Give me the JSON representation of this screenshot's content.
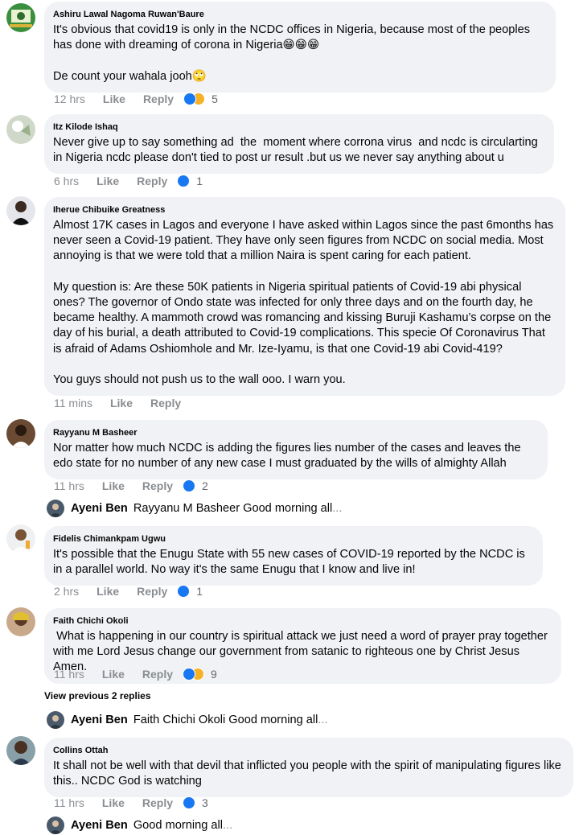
{
  "comments": [
    {
      "author": "Ashiru Lawal Nagoma Ruwan'Baure",
      "text": "It's obvious that covid19 is only in the NCDC offices in Nigeria, because most of the peoples has done with dreaming of corona in Nigeria😁😁😁\n\nDe count your wahala jooh🙄",
      "time": "12 hrs",
      "like": "Like",
      "reply": "Reply",
      "reactions": [
        "like",
        "haha"
      ],
      "count": "5"
    },
    {
      "author": "Itz Kilode Ishaq",
      "text": "Never give up to say something ad  the  moment where corrona virus  and ncdc is circularting in Nigeria ncdc please don't tied to post ur result .but us we never say anything about u",
      "time": "6 hrs",
      "like": "Like",
      "reply": "Reply",
      "reactions": [
        "like"
      ],
      "count": "1"
    },
    {
      "author": "Iherue Chibuike Greatness",
      "text": "Almost 17K cases in Lagos and everyone I have asked within Lagos since the past 6months has never seen a Covid-19 patient. They have only seen figures from NCDC on social media. Most annoying is that we were told that a million Naira is spent caring for each patient.\n\nMy question is: Are these 50K patients in Nigeria spiritual patients of Covid-19 abi physical ones? The governor of Ondo state was infected for only three days and on the fourth day, he became healthy. A mammoth crowd was romancing and kissing Buruji Kashamu’s corpse on the day of his burial, a death attributed to Covid-19 complications. This specie Of Coronavirus That is afraid of Adams Oshiomhole and Mr. Ize-Iyamu, is that one Covid-19 abi Covid-419?\n\nYou guys should not push us to the wall ooo. I warn you.",
      "time": "11 mins",
      "like": "Like",
      "reply": "Reply",
      "reactions": [],
      "count": ""
    },
    {
      "author": "Rayyanu M Basheer",
      "text": "Nor matter how much NCDC is adding the figures lies number of the cases and leaves the edo state for no number of any new case I must graduated by the wills of almighty Allah",
      "time": "11 hrs",
      "like": "Like",
      "reply": "Reply",
      "reactions": [
        "like"
      ],
      "count": "2"
    },
    {
      "author": "Fidelis Chimankpam Ugwu",
      "text": "It's possible that the Enugu State with 55 new cases of COVID-19 reported by the NCDC is in a parallel world. No way it's the same Enugu that I know and live in!",
      "time": "2 hrs",
      "like": "Like",
      "reply": "Reply",
      "reactions": [
        "like"
      ],
      "count": "1"
    },
    {
      "author": "Faith Chichi Okoli",
      "text": " What is happening in our country is spiritual attack we just need a word of prayer pray together with me Lord Jesus change our government from satanic to righteous one by Christ Jesus Amen.",
      "time": "11 hrs",
      "like": "Like",
      "reply": "Reply",
      "reactions": [
        "like",
        "haha"
      ],
      "count": "9"
    },
    {
      "author": "Collins Ottah",
      "text": "It shall not be well with that devil that inflicted you people with the spirit of manipulating figures like this.. NCDC God is watching",
      "time": "11 hrs",
      "like": "Like",
      "reply": "Reply",
      "reactions": [
        "like"
      ],
      "count": "3"
    }
  ],
  "replies": [
    {
      "name": "Ayeni Ben",
      "text": "Rayyanu M Basheer Good morning all",
      "ellipsis": "..."
    },
    {
      "name": "Ayeni Ben",
      "text": "Faith Chichi Okoli Good morning all",
      "ellipsis": "..."
    },
    {
      "name": "Ayeni Ben",
      "text": "Good morning all",
      "ellipsis": "..."
    }
  ],
  "view_previous": "View previous 2 replies",
  "colors": {
    "bubble": "#f0f2f5",
    "meta": "#8a8d91",
    "like_blue": "#1877f2",
    "haha_yellow": "#f7b125"
  },
  "icons": {
    "like": "thumbs-up-icon",
    "haha": "laughing-face-icon"
  }
}
